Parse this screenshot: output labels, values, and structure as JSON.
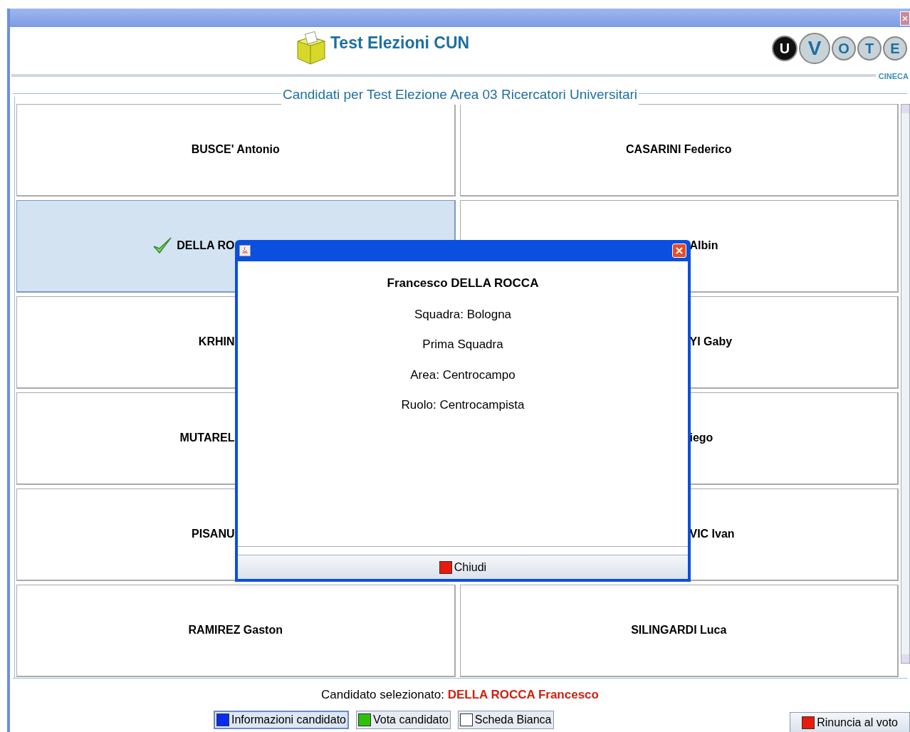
{
  "header": {
    "title": "Test Elezioni CUN",
    "logo_letters": [
      "U",
      "V",
      "O",
      "T",
      "E"
    ],
    "brand": "CINECA"
  },
  "panel": {
    "legend": "Candidati per Test Elezione Area 03 Ricercatori Universitari"
  },
  "candidates": [
    {
      "name": "BUSCE' Antonio",
      "selected": false,
      "kind": "whole"
    },
    {
      "name": "CASARINI Federico",
      "selected": false,
      "kind": "whole"
    },
    {
      "name": "DELLA RO",
      "selected": true,
      "kind": "tailcut"
    },
    {
      "name": "Albin",
      "selected": false,
      "kind": "headcut"
    },
    {
      "name": "KRHIN",
      "selected": false,
      "kind": "tailcut"
    },
    {
      "name": "YI Gaby",
      "selected": false,
      "kind": "headcut"
    },
    {
      "name": "MUTAREL",
      "selected": false,
      "kind": "tailcut"
    },
    {
      "name": "iego",
      "selected": false,
      "kind": "headcut"
    },
    {
      "name": "PISANU",
      "selected": false,
      "kind": "tailcut"
    },
    {
      "name": "VIC Ivan",
      "selected": false,
      "kind": "headcut"
    },
    {
      "name": "RAMIREZ Gaston",
      "selected": false,
      "kind": "whole"
    },
    {
      "name": "SILINGARDI Luca",
      "selected": false,
      "kind": "whole"
    }
  ],
  "selection": {
    "label": "Candidato selezionato:",
    "value": "DELLA ROCCA Francesco"
  },
  "buttons": [
    {
      "label": "Informazioni candidato",
      "color": "#0a2cf0",
      "selected": true
    },
    {
      "label": "Vota candidato",
      "color": "#2fc10a",
      "selected": false
    },
    {
      "label": "Scheda Bianca",
      "color": "#ffffff",
      "selected": false
    }
  ],
  "quit_button": {
    "label": "Rinuncia al voto",
    "color": "#e81a0a"
  },
  "dialog": {
    "heading": "Francesco DELLA ROCCA",
    "lines": [
      "Squadra: Bologna",
      "Prima Squadra",
      "Area: Centrocampo",
      "Ruolo: Centrocampista"
    ],
    "close_button": {
      "label": "Chiudi",
      "color": "#e81a0a"
    }
  }
}
